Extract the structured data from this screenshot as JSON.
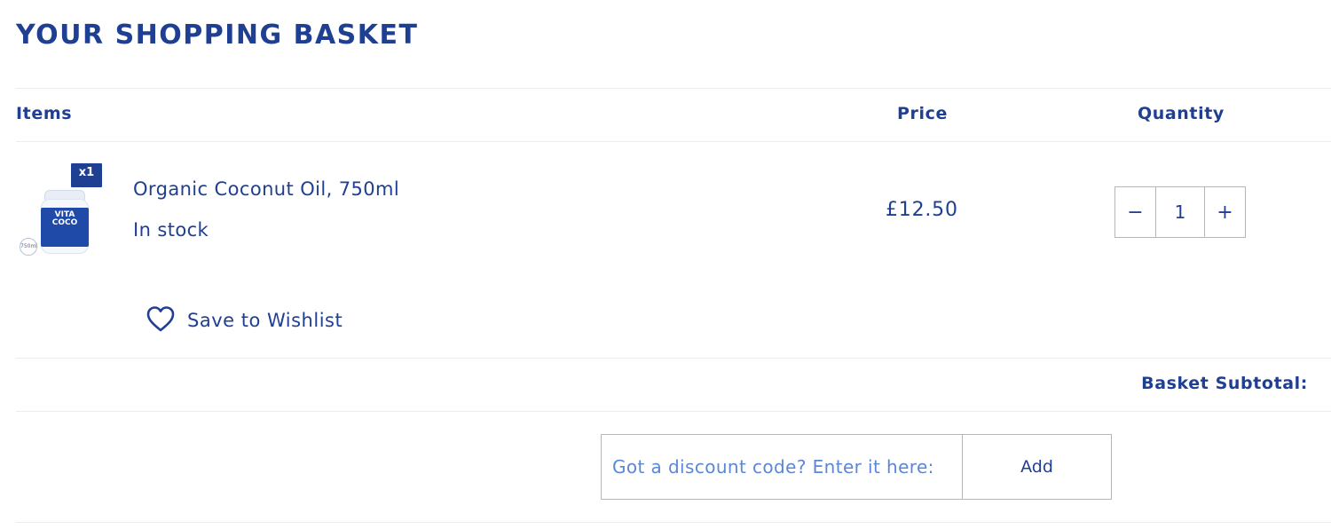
{
  "page_title": "YOUR SHOPPING BASKET",
  "table": {
    "headers": {
      "items": "Items",
      "price": "Price",
      "quantity": "Quantity"
    }
  },
  "item": {
    "badge": "x1",
    "thumb_brand": "VITA COCO",
    "thumb_size": "750ml",
    "name": "Organic Coconut Oil, 750ml",
    "stock": "In stock",
    "price": "£12.50",
    "quantity": "1",
    "decrement_symbol": "−",
    "increment_symbol": "+",
    "wishlist_label": "Save to Wishlist",
    "wishlist_icon": "heart-icon"
  },
  "subtotal": {
    "label": "Basket Subtotal:"
  },
  "discount": {
    "placeholder": "Got a discount code? Enter it here:",
    "value": "",
    "button_label": "Add"
  },
  "colors": {
    "brand": "#1f3f93",
    "placeholder": "#5b87d6",
    "border": "#b6b6b6",
    "divider": "#ececec"
  }
}
